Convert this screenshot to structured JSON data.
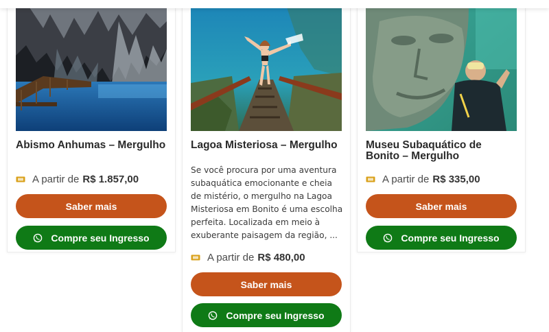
{
  "cards": [
    {
      "title": "Abismo Anhumas – Mergulho",
      "description": "",
      "price_label": "A partir de",
      "price_value": "R$ 1.857,00",
      "more_button": "Saber mais",
      "buy_button": "Compre seu Ingresso"
    },
    {
      "title": "Lagoa Misteriosa – Mergulho",
      "description": "Se você procura por uma aventura subaquática emocionante e cheia de mistério, o mergulho na Lagoa Misteriosa em Bonito é uma escolha perfeita. Localizada em meio à exuberante paisagem da região, ...",
      "price_label": "A partir de",
      "price_value": "R$ 480,00",
      "more_button": "Saber mais",
      "buy_button": "Compre seu Ingresso"
    },
    {
      "title": "Museu Subaquático de Bonito – Mergulho",
      "description": "",
      "price_label": "A partir de",
      "price_value": "R$ 335,00",
      "more_button": "Saber mais",
      "buy_button": "Compre seu Ingresso"
    }
  ],
  "icons": {
    "price": "ticket-icon",
    "buy": "whatsapp-icon"
  },
  "colors": {
    "more_button": "#c5541b",
    "buy_button": "#0f7a16",
    "ticket_icon": "#d9a019"
  }
}
